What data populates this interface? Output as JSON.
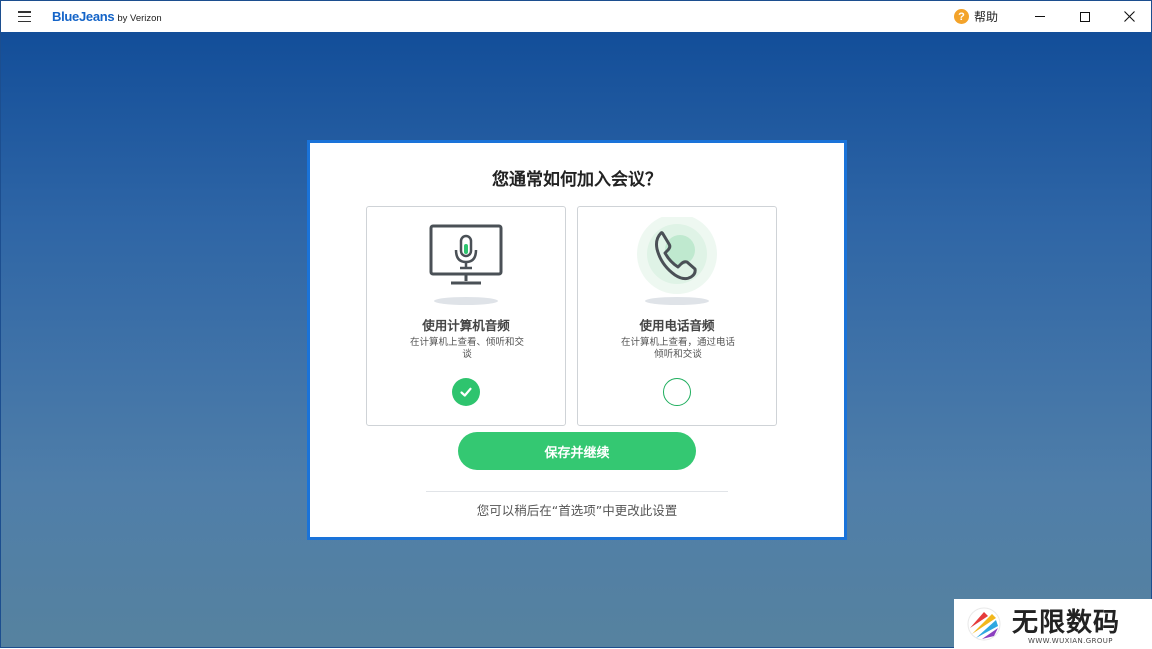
{
  "titlebar": {
    "brand_main": "BlueJeans",
    "brand_sub": "by Verizon",
    "help_icon_glyph": "?",
    "help_label": "帮助",
    "close_glyph": "✕"
  },
  "dialog": {
    "title": "您通常如何加入会议？",
    "options": [
      {
        "title": "使用计算机音频",
        "desc": "在计算机上查看、倾听和交谈",
        "selected": true,
        "icon": "monitor-microphone-icon"
      },
      {
        "title": "使用电话音频",
        "desc": "在计算机上查看，通过电话倾听和交谈",
        "selected": false,
        "icon": "phone-icon"
      }
    ],
    "primary_button": "保存并继续",
    "footnote": "您可以稍后在“首选项”中更改此设置"
  },
  "watermark": {
    "title": "无限数码",
    "subtitle": "WWW.WUXIAN.GROUP"
  },
  "colors": {
    "accent_green": "#34c872",
    "brand_blue": "#1464c8",
    "dialog_border": "#1a73d9",
    "help_orange": "#f3a32a"
  }
}
